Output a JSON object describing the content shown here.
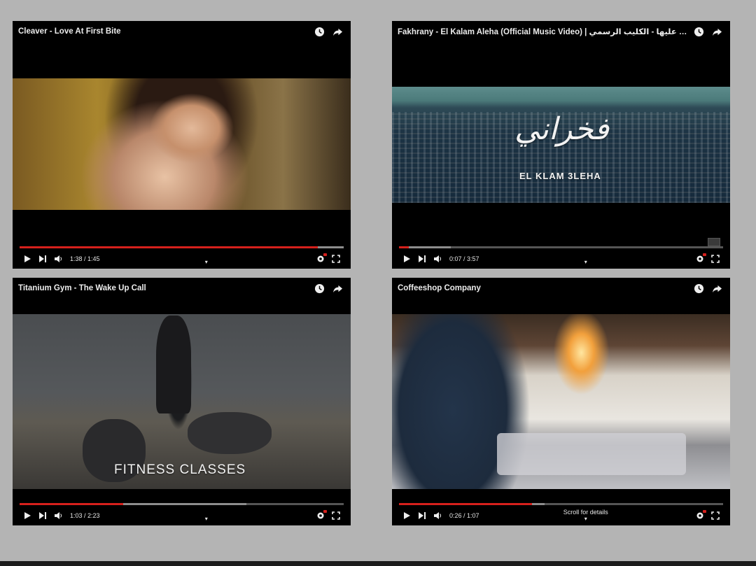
{
  "videos": [
    {
      "title": "Cleaver - Love At First Bite",
      "time": "1:38 / 1:45",
      "progress": 0.92,
      "loaded": 1.0,
      "mid_text": ""
    },
    {
      "title": "Fakhrany - El Kalam Aleha (Official Music Video) | فخراني - الكلام عليها - الكليب الرسمي",
      "time": "0:07 / 3:57",
      "progress": 0.03,
      "loaded": 0.16,
      "mid_text": "",
      "overlay_arabic": "فخراني",
      "overlay_sub": "EL KLAM 3LEHA"
    },
    {
      "title": "Titanium Gym - The Wake Up Call",
      "time": "1:03 / 2:23",
      "progress": 0.32,
      "loaded": 0.7,
      "mid_text": "",
      "overlay_text": "FITNESS CLASSES"
    },
    {
      "title": "Coffeeshop Company",
      "time": "0:26 / 1:07",
      "progress": 0.41,
      "loaded": 0.45,
      "mid_text": "Scroll for details"
    }
  ],
  "icons": {
    "watch_later": "clock-icon",
    "share": "share-icon",
    "play": "play-icon",
    "next": "next-icon",
    "volume": "volume-icon",
    "settings": "settings-icon",
    "fullscreen": "fullscreen-icon"
  },
  "colors": {
    "progress_played": "#d6201c",
    "background": "#b4b4b4"
  }
}
